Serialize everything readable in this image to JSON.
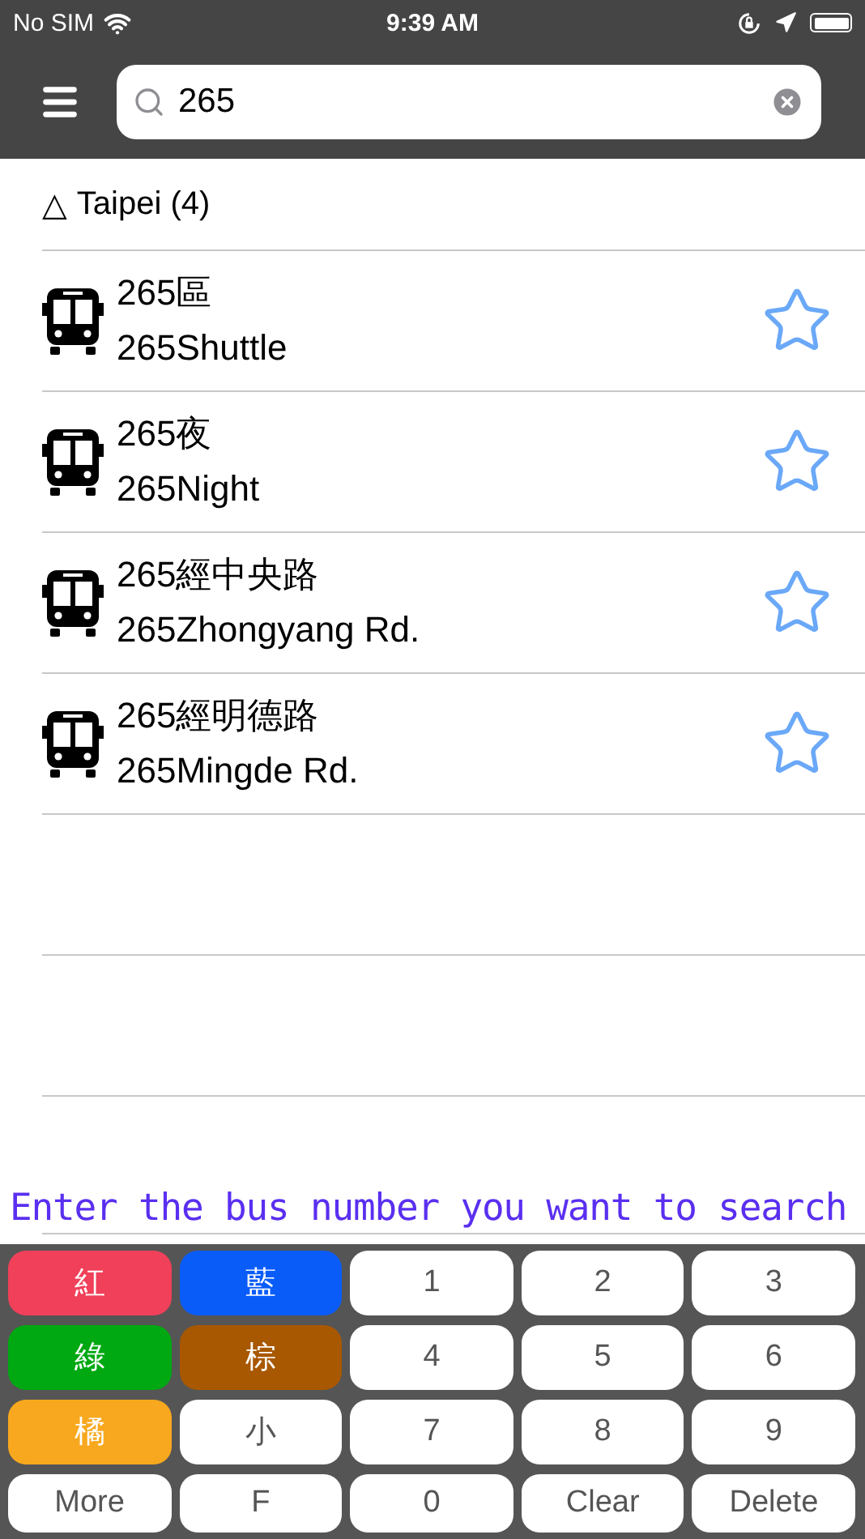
{
  "status_bar": {
    "carrier": "No SIM",
    "time": "9:39 AM"
  },
  "search": {
    "value": "265"
  },
  "group": {
    "marker": "△",
    "title": "Taipei (4)"
  },
  "routes": [
    {
      "name": "265區",
      "subtitle": "265Shuttle",
      "favorite": false
    },
    {
      "name": "265夜",
      "subtitle": "265Night",
      "favorite": false
    },
    {
      "name": "265經中央路",
      "subtitle": "265Zhongyang Rd.",
      "favorite": false
    },
    {
      "name": "265經明德路",
      "subtitle": "265Mingde Rd.",
      "favorite": false
    }
  ],
  "hint": "Enter the bus number you want to search",
  "keypad": [
    {
      "label": "紅",
      "kind": "color",
      "color": "#f0405a"
    },
    {
      "label": "藍",
      "kind": "color",
      "color": "#0a5cf8"
    },
    {
      "label": "1",
      "kind": "plain"
    },
    {
      "label": "2",
      "kind": "plain"
    },
    {
      "label": "3",
      "kind": "plain"
    },
    {
      "label": "綠",
      "kind": "color",
      "color": "#00a812"
    },
    {
      "label": "棕",
      "kind": "color",
      "color": "#a85800"
    },
    {
      "label": "4",
      "kind": "plain"
    },
    {
      "label": "5",
      "kind": "plain"
    },
    {
      "label": "6",
      "kind": "plain"
    },
    {
      "label": "橘",
      "kind": "color",
      "color": "#f8a81e"
    },
    {
      "label": "小",
      "kind": "plain"
    },
    {
      "label": "7",
      "kind": "plain"
    },
    {
      "label": "8",
      "kind": "plain"
    },
    {
      "label": "9",
      "kind": "plain"
    },
    {
      "label": "More",
      "kind": "plain"
    },
    {
      "label": "F",
      "kind": "plain"
    },
    {
      "label": "0",
      "kind": "plain"
    },
    {
      "label": "Clear",
      "kind": "plain"
    },
    {
      "label": "Delete",
      "kind": "plain"
    }
  ]
}
